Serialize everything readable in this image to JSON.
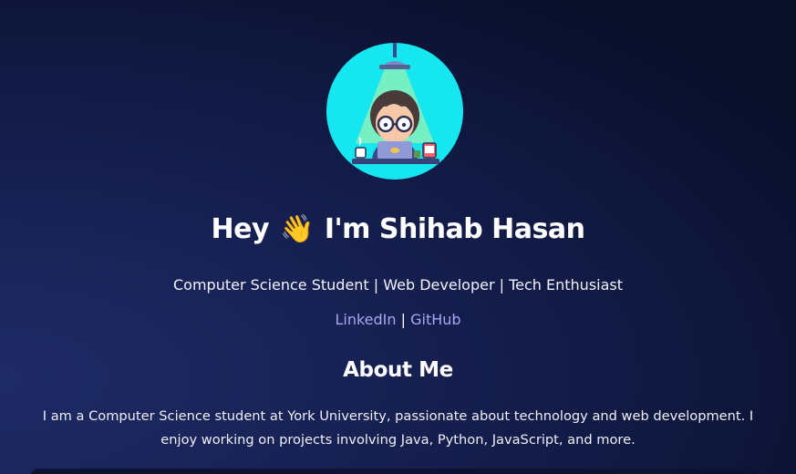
{
  "profile": {
    "avatar_alt": "avatar-illustration",
    "greeting_prefix": "Hey",
    "wave_emoji": "👋",
    "greeting_name": "I'm Shihab Hasan",
    "tagline": "Computer Science Student | Web Developer | Tech Enthusiast"
  },
  "links": {
    "linkedin": "LinkedIn",
    "separator": "|",
    "github": "GitHub"
  },
  "about": {
    "title": "About Me",
    "text": "I am a Computer Science student at York University, passionate about technology and web development. I enjoy working on projects involving Java, Python, JavaScript, and more."
  },
  "colors": {
    "background": "#182255",
    "avatar_bg": "#16e6f0",
    "link": "#a6a8f0",
    "text": "#ffffff"
  }
}
